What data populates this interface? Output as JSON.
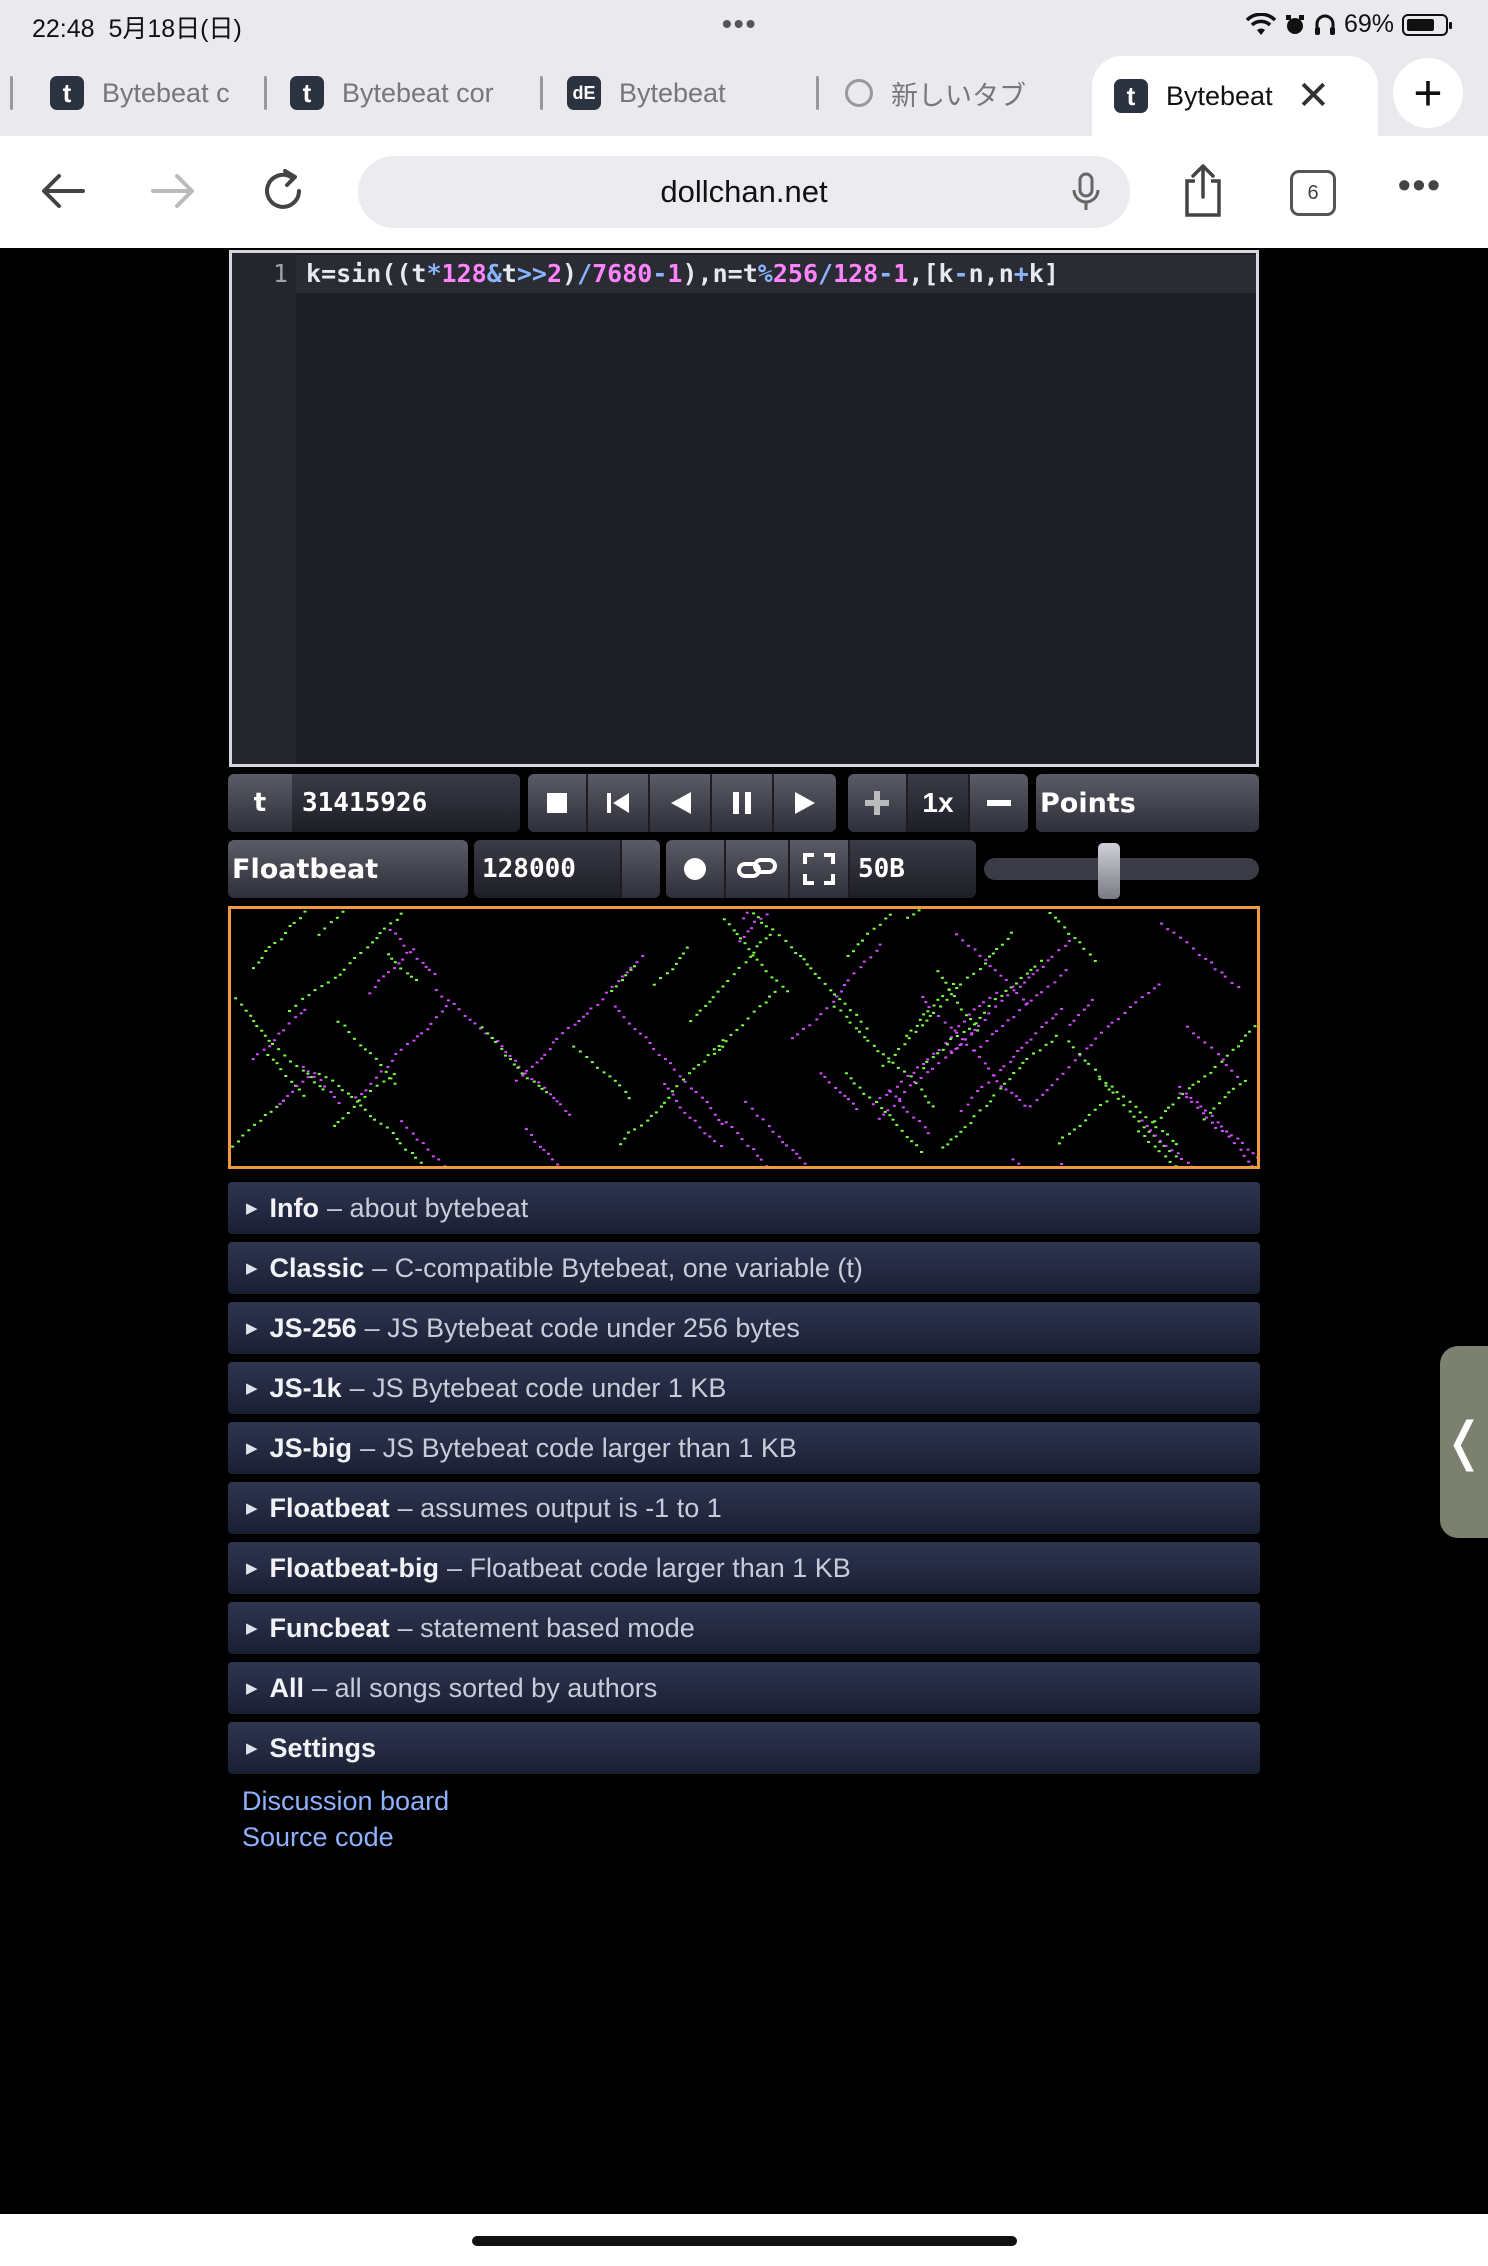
{
  "status": {
    "time": "22:48",
    "date": "5月18日(日)",
    "battery": "69%"
  },
  "tabs": [
    {
      "title": "Bytebeat c",
      "favicon": "t"
    },
    {
      "title": "Bytebeat cor",
      "favicon": "t"
    },
    {
      "title": "Bytebeat",
      "favicon": "dE"
    },
    {
      "title": "新しいタブ",
      "favicon": "globe"
    },
    {
      "title": "Bytebeat",
      "favicon": "t"
    }
  ],
  "toolbar": {
    "address": "dollchan.net",
    "tab_count": "6"
  },
  "editor": {
    "line_number": "1",
    "code": "k=sin((t*128&t>>2)/7680-1),n=t%256/128-1,[k-n,n+k]"
  },
  "controls": {
    "t_label": "t",
    "t_value": "31415926",
    "speed": "1x",
    "draw_mode": "Points",
    "mode": "Floatbeat",
    "sample_rate": "128000",
    "code_size": "50B",
    "volume": 0.45
  },
  "sections": [
    {
      "name": "Info",
      "desc": "– about bytebeat"
    },
    {
      "name": "Classic",
      "desc": "– C-compatible Bytebeat, one variable (t)"
    },
    {
      "name": "JS-256",
      "desc": "– JS Bytebeat code under 256 bytes"
    },
    {
      "name": "JS-1k",
      "desc": "– JS Bytebeat code under 1 KB"
    },
    {
      "name": "JS-big",
      "desc": "– JS Bytebeat code larger than 1 KB"
    },
    {
      "name": "Floatbeat",
      "desc": "– assumes output is -1 to 1"
    },
    {
      "name": "Floatbeat-big",
      "desc": "– Floatbeat code larger than 1 KB"
    },
    {
      "name": "Funcbeat",
      "desc": "– statement based mode"
    },
    {
      "name": "All",
      "desc": "– all songs sorted by authors"
    },
    {
      "name": "Settings",
      "desc": ""
    }
  ],
  "links": {
    "discussion": "Discussion board",
    "source": "Source code"
  },
  "colors": {
    "scope_border": "#ef9a3c",
    "accent_link": "#8fb1ff",
    "scope_left": "#7bff4a",
    "scope_right": "#d34bff"
  }
}
